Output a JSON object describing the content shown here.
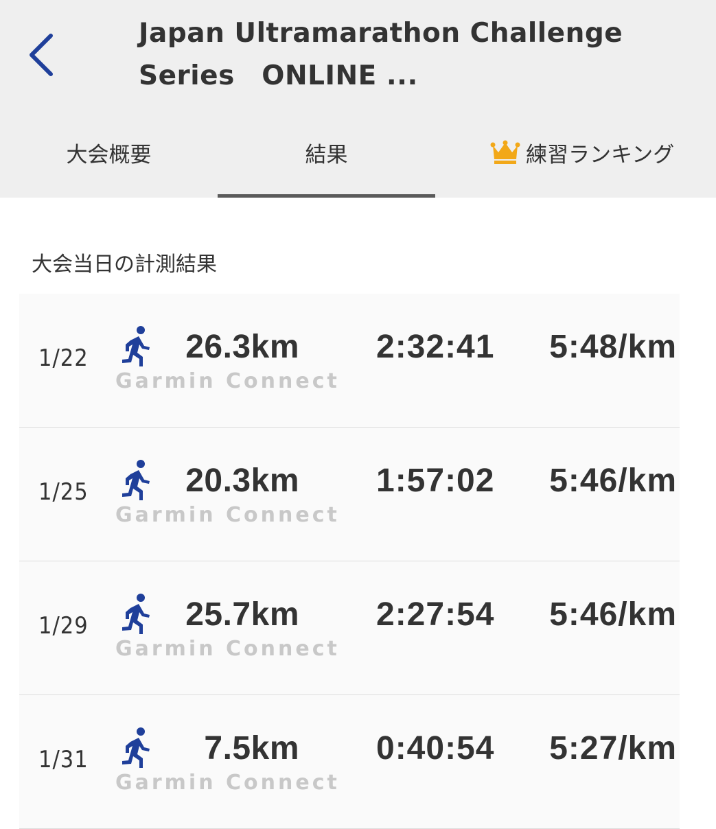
{
  "header": {
    "title": "Japan Ultramarathon Challenge\nSeries　ONLINE ...",
    "back_icon": "chevron-left-icon",
    "accent_color": "#1f3f9a"
  },
  "tabs": [
    {
      "label": "大会概要",
      "active": false
    },
    {
      "label": "結果",
      "active": true
    },
    {
      "label": "練習ランキング",
      "active": false,
      "icon": "crown-icon",
      "icon_color": "#f2a818"
    }
  ],
  "section": {
    "title": "大会当日の計測結果"
  },
  "results": [
    {
      "date": "1/22",
      "distance": "26.3km",
      "source": "Garmin Connect",
      "time": "2:32:41",
      "pace": "5:48/km"
    },
    {
      "date": "1/25",
      "distance": "20.3km",
      "source": "Garmin Connect",
      "time": "1:57:02",
      "pace": "5:46/km"
    },
    {
      "date": "1/29",
      "distance": "25.7km",
      "source": "Garmin Connect",
      "time": "2:27:54",
      "pace": "5:46/km"
    },
    {
      "date": "1/31",
      "distance": "7.5km",
      "source": "Garmin Connect",
      "time": "0:40:54",
      "pace": "5:27/km"
    }
  ]
}
